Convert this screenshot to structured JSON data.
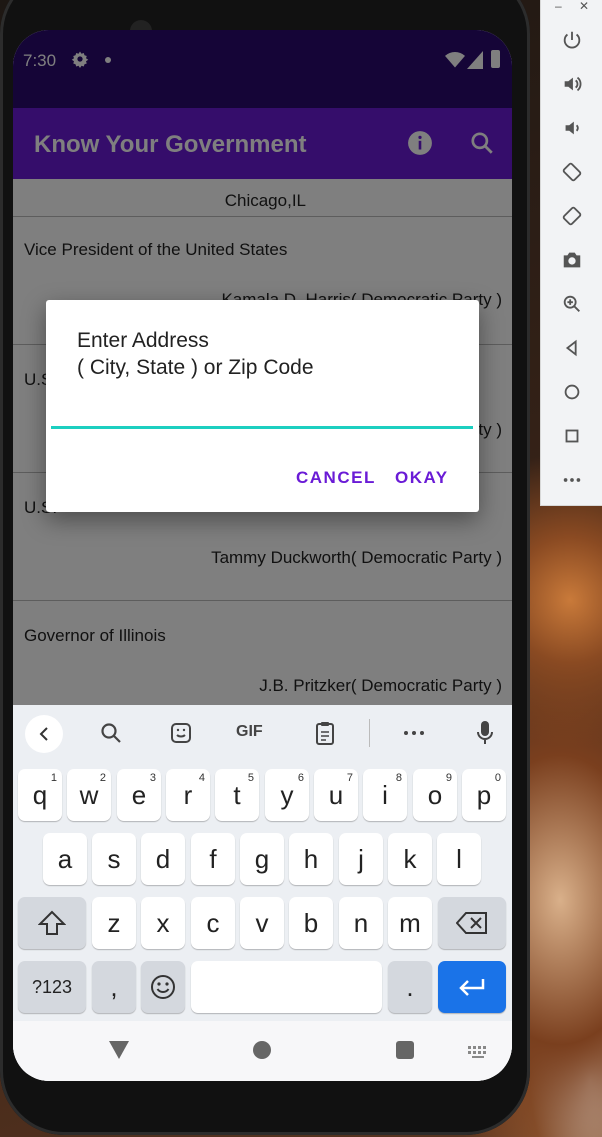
{
  "status": {
    "time": "7:30"
  },
  "app": {
    "title": "Know Your Government"
  },
  "officials": [
    {
      "office": "",
      "official": "Chicago,IL"
    },
    {
      "office": "Vice President of the United States",
      "official": "Kamala D. Harris( Democratic Party )"
    },
    {
      "office": "U.S.",
      "official": "( Democratic Party )"
    },
    {
      "office": "U.S.",
      "official": "Tammy Duckworth( Democratic Party )"
    },
    {
      "office": "Governor of Illinois",
      "official": "J.B. Pritzker( Democratic Party )"
    }
  ],
  "dialog": {
    "title": "Enter Address\n( City, State ) or Zip Code",
    "input_value": "",
    "cancel_label": "CANCEL",
    "okay_label": "OKAY"
  },
  "keyboard": {
    "row1": [
      {
        "k": "q",
        "n": "1"
      },
      {
        "k": "w",
        "n": "2"
      },
      {
        "k": "e",
        "n": "3"
      },
      {
        "k": "r",
        "n": "4"
      },
      {
        "k": "t",
        "n": "5"
      },
      {
        "k": "y",
        "n": "6"
      },
      {
        "k": "u",
        "n": "7"
      },
      {
        "k": "i",
        "n": "8"
      },
      {
        "k": "o",
        "n": "9"
      },
      {
        "k": "p",
        "n": "0"
      }
    ],
    "row2": [
      "a",
      "s",
      "d",
      "f",
      "g",
      "h",
      "j",
      "k",
      "l"
    ],
    "row3": [
      "z",
      "x",
      "c",
      "v",
      "b",
      "n",
      "m"
    ],
    "symbols_label": "?123",
    "comma": ",",
    "period": ".",
    "gif_label": "GIF"
  },
  "colors": {
    "status_bar": "#2a0a6e",
    "app_bar": "#6a1bd6",
    "accent": "#1ccfc0",
    "enter_key": "#1a73e8"
  },
  "icons": [
    "settings-icon",
    "wifi-icon",
    "signal-icon",
    "battery-icon",
    "info-icon",
    "search-icon",
    "power-icon",
    "volume-up-icon",
    "volume-down-icon",
    "rotate-left-icon",
    "rotate-right-icon",
    "camera-icon",
    "zoom-icon",
    "back-icon",
    "home-icon",
    "overview-icon",
    "more-icon"
  ]
}
